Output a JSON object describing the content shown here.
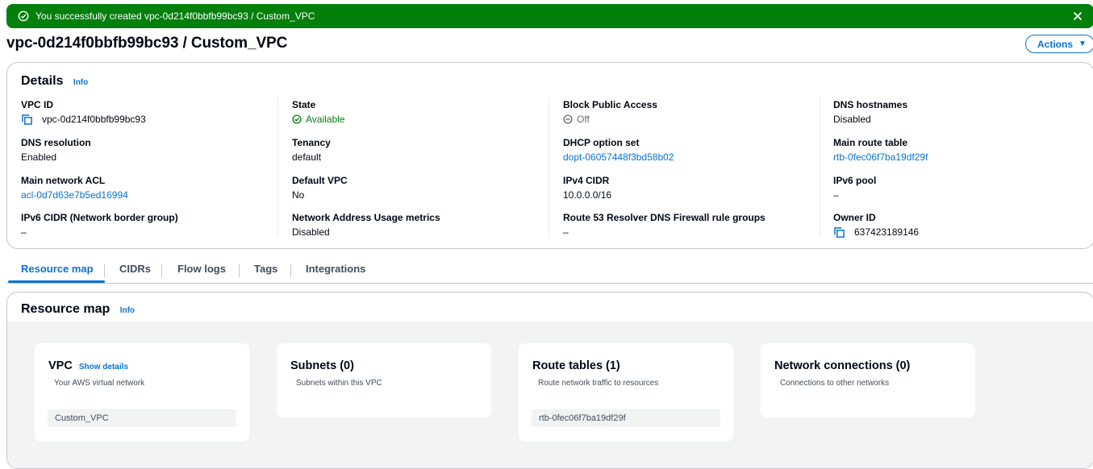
{
  "flash": {
    "message": "You successfully created vpc-0d214f0bbfb99bc93 / Custom_VPC",
    "icons": {
      "status": "check-circle-icon",
      "close": "close-icon"
    },
    "color": "#037f0c"
  },
  "page": {
    "title": "vpc-0d214f0bbfb99bc93 / Custom_VPC",
    "actions_label": "Actions"
  },
  "details": {
    "heading": "Details",
    "info": "Info",
    "vpc_id": {
      "label": "VPC ID",
      "value": "vpc-0d214f0bbfb99bc93"
    },
    "state": {
      "label": "State",
      "value": "Available"
    },
    "block_public_access": {
      "label": "Block Public Access",
      "value": "Off"
    },
    "dns_hostnames": {
      "label": "DNS hostnames",
      "value": "Disabled"
    },
    "dns_resolution": {
      "label": "DNS resolution",
      "value": "Enabled"
    },
    "tenancy": {
      "label": "Tenancy",
      "value": "default"
    },
    "dhcp_option_set": {
      "label": "DHCP option set",
      "value": "dopt-06057448f3bd58b02"
    },
    "main_route_table": {
      "label": "Main route table",
      "value": "rtb-0fec06f7ba19df29f"
    },
    "main_network_acl": {
      "label": "Main network ACL",
      "value": "acl-0d7d63e7b5ed16994"
    },
    "default_vpc": {
      "label": "Default VPC",
      "value": "No"
    },
    "ipv4_cidr": {
      "label": "IPv4 CIDR",
      "value": "10.0.0.0/16"
    },
    "ipv6_pool": {
      "label": "IPv6 pool",
      "value": "–"
    },
    "ipv6_cidr": {
      "label": "IPv6 CIDR (Network border group)",
      "value": "–"
    },
    "nau_metrics": {
      "label": "Network Address Usage metrics",
      "value": "Disabled"
    },
    "route53": {
      "label": "Route 53 Resolver DNS Firewall rule groups",
      "value": "–"
    },
    "owner_id": {
      "label": "Owner ID",
      "value": "637423189146"
    }
  },
  "tabs": [
    "Resource map",
    "CIDRs",
    "Flow logs",
    "Tags",
    "Integrations"
  ],
  "resource_map": {
    "heading": "Resource map",
    "info": "Info",
    "vpc": {
      "title": "VPC",
      "show_details": "Show details",
      "subtitle": "Your AWS virtual network",
      "item": "Custom_VPC"
    },
    "subnets": {
      "title": "Subnets (0)",
      "subtitle": "Subnets within this VPC"
    },
    "route_tables": {
      "title": "Route tables (1)",
      "subtitle": "Route network traffic to resources",
      "item": "rtb-0fec06f7ba19df29f"
    },
    "network_connections": {
      "title": "Network connections (0)",
      "subtitle": "Connections to other networks"
    }
  },
  "colors": {
    "link": "#0972d3",
    "success": "#037f0c",
    "text": "#000716"
  }
}
